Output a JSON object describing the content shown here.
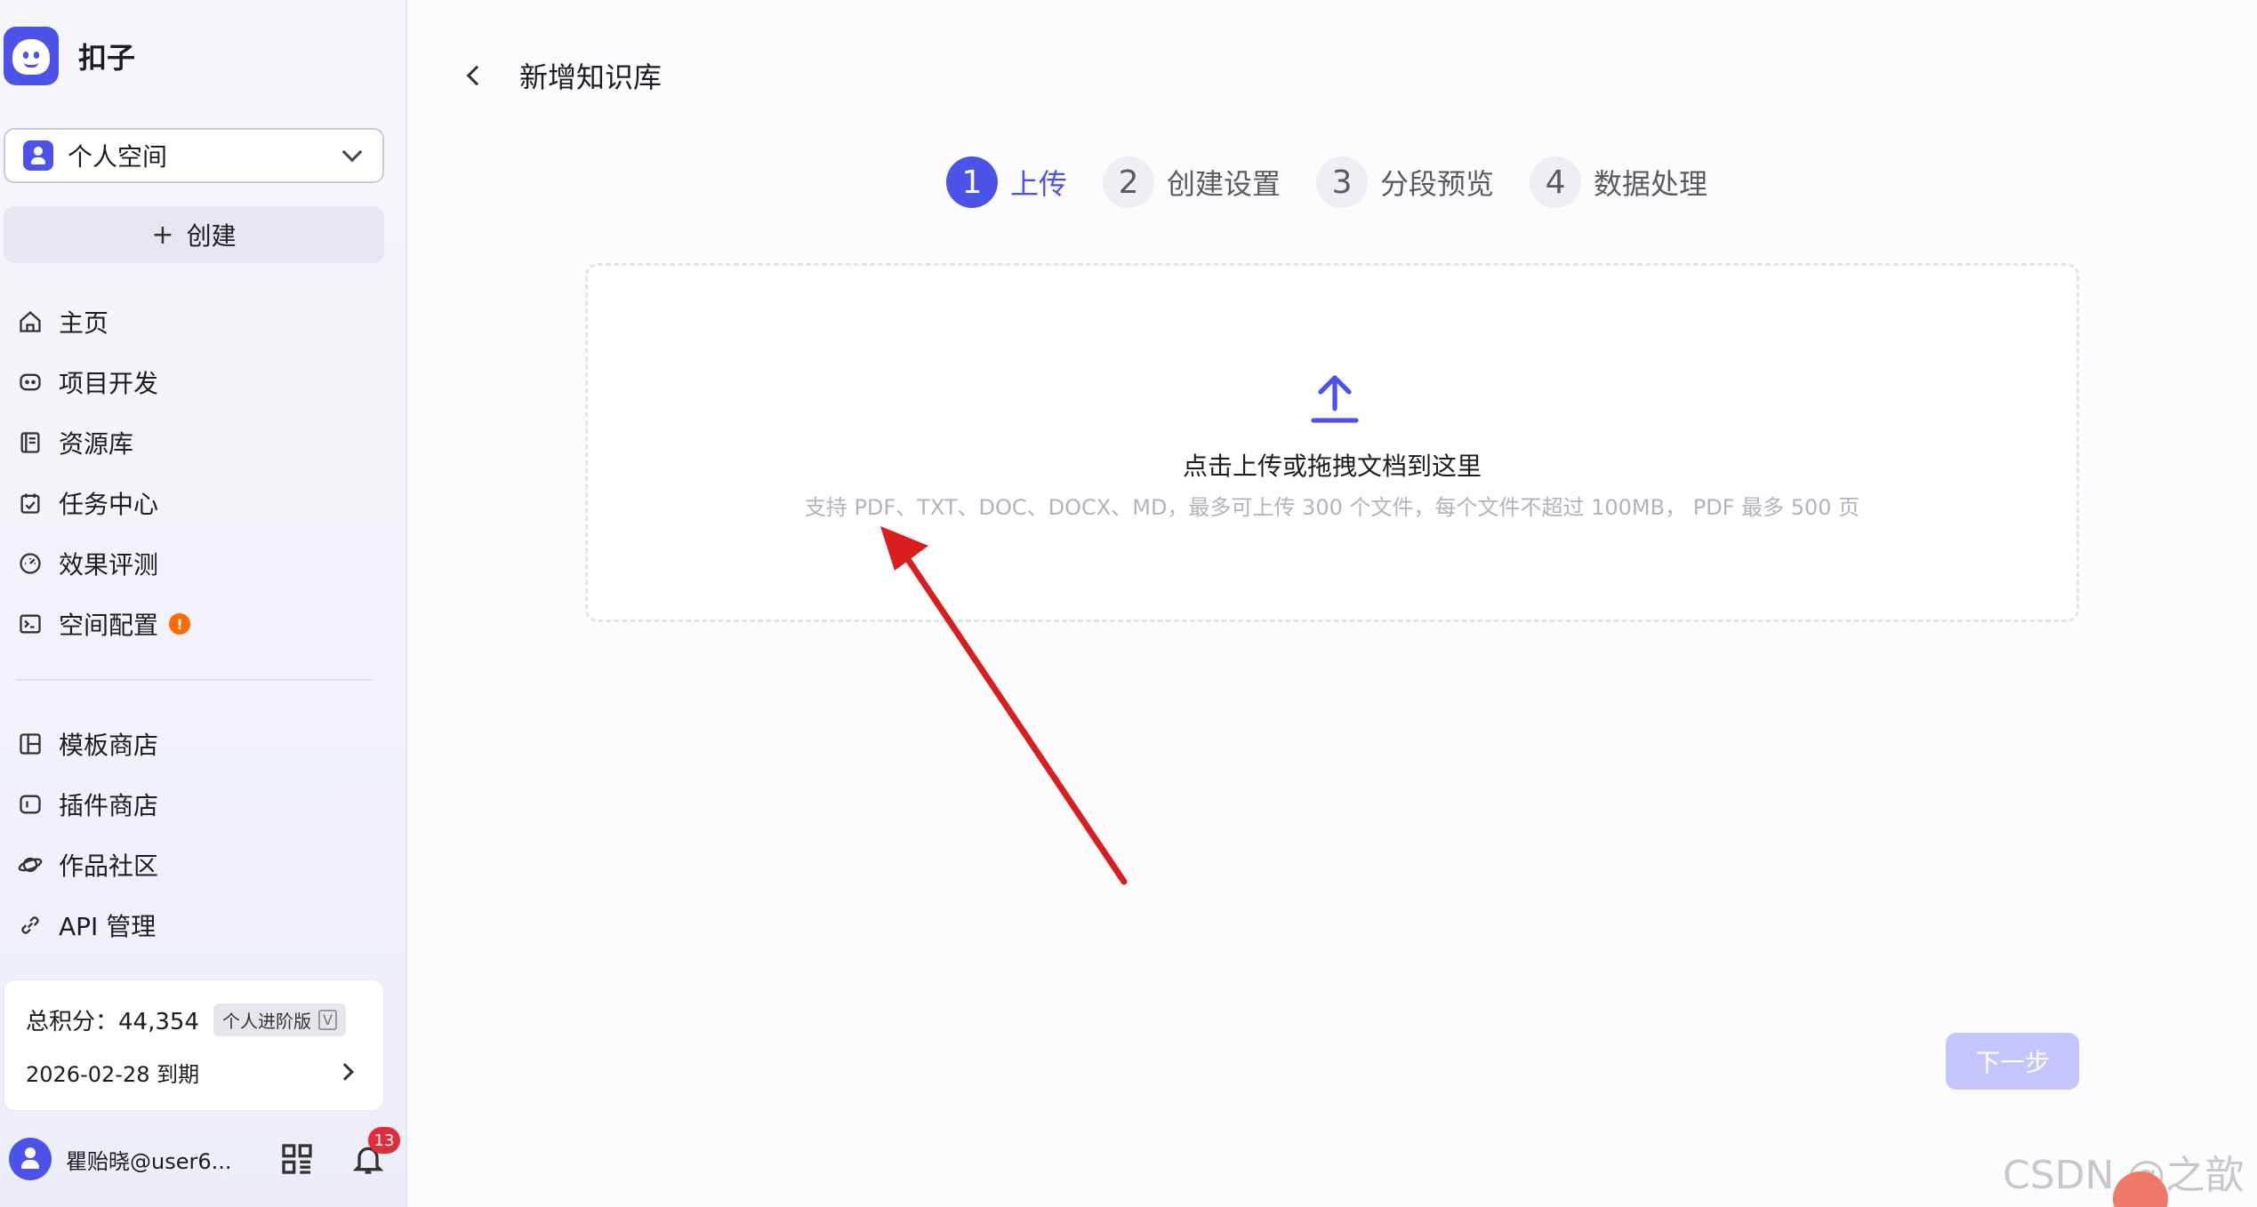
{
  "brand": {
    "name": "扣子"
  },
  "space": {
    "label": "个人空间"
  },
  "create": {
    "label": "创建"
  },
  "nav": [
    {
      "id": "home",
      "label": "主页",
      "icon": "home-icon"
    },
    {
      "id": "projects",
      "label": "项目开发",
      "icon": "bot-icon"
    },
    {
      "id": "resources",
      "label": "资源库",
      "icon": "library-icon"
    },
    {
      "id": "tasks",
      "label": "任务中心",
      "icon": "task-icon"
    },
    {
      "id": "evaluation",
      "label": "效果评测",
      "icon": "gauge-icon"
    },
    {
      "id": "space-config",
      "label": "空间配置",
      "icon": "terminal-icon",
      "badge": "!"
    }
  ],
  "nav2": [
    {
      "id": "template-store",
      "label": "模板商店",
      "icon": "layout-icon"
    },
    {
      "id": "plugin-store",
      "label": "插件商店",
      "icon": "plugin-icon"
    },
    {
      "id": "community",
      "label": "作品社区",
      "icon": "planet-icon"
    },
    {
      "id": "api",
      "label": "API 管理",
      "icon": "link-icon"
    }
  ],
  "points": {
    "label": "总积分：44,354",
    "tier": "个人进阶版",
    "tier_mark": "V",
    "expiry": "2026-02-28 到期"
  },
  "user": {
    "name": "瞿贻晓@user6...",
    "notifications": "13"
  },
  "page": {
    "title": "新增知识库"
  },
  "steps": [
    {
      "num": "1",
      "label": "上传",
      "active": true
    },
    {
      "num": "2",
      "label": "创建设置",
      "active": false
    },
    {
      "num": "3",
      "label": "分段预览",
      "active": false
    },
    {
      "num": "4",
      "label": "数据处理",
      "active": false
    }
  ],
  "upload": {
    "title": "点击上传或拖拽文档到这里",
    "hint": "支持 PDF、TXT、DOC、DOCX、MD，最多可上传 300 个文件，每个文件不超过 100MB， PDF 最多 500 页"
  },
  "next": {
    "label": "下一步"
  },
  "watermark": "CSDN @之歆",
  "colors": {
    "accent": "#4d53e8",
    "next_disabled": "#c4c6fb",
    "annotation_arrow": "#d81e1e",
    "badge": "#ff6a00"
  }
}
